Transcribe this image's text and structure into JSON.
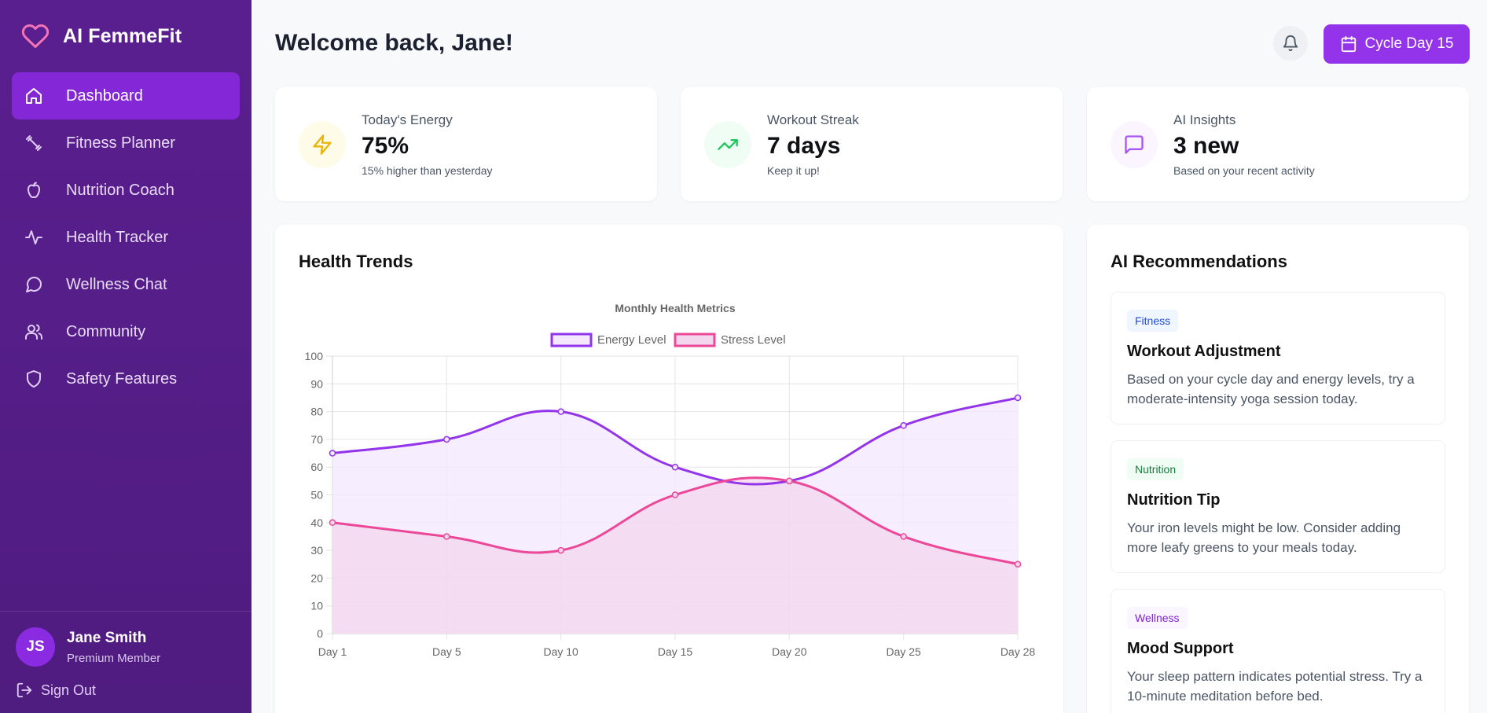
{
  "app": {
    "name": "AI FemmeFit",
    "logo_icon": "heart-icon",
    "brand_color": "#f472b6",
    "sidebar_color": "#5a1f8f",
    "accent_color": "#9333ea"
  },
  "sidebar": {
    "items": [
      {
        "label": "Dashboard",
        "icon": "home-icon",
        "active": true
      },
      {
        "label": "Fitness Planner",
        "icon": "dumbbell-icon",
        "active": false
      },
      {
        "label": "Nutrition Coach",
        "icon": "apple-icon",
        "active": false
      },
      {
        "label": "Health Tracker",
        "icon": "activity-icon",
        "active": false
      },
      {
        "label": "Wellness Chat",
        "icon": "chat-icon",
        "active": false
      },
      {
        "label": "Community",
        "icon": "users-icon",
        "active": false
      },
      {
        "label": "Safety Features",
        "icon": "shield-icon",
        "active": false
      }
    ],
    "user": {
      "initials": "JS",
      "name": "Jane Smith",
      "role": "Premium Member"
    },
    "signout_label": "Sign Out"
  },
  "header": {
    "title": "Welcome back, Jane!",
    "notification_icon": "bell-icon",
    "cycle_label": "Cycle Day 15",
    "cycle_icon": "calendar-icon"
  },
  "stats": [
    {
      "label": "Today's Energy",
      "value": "75%",
      "sub": "15% higher than yesterday",
      "icon": "lightning-icon",
      "icon_color": "#eab308",
      "icon_bg": "#fefce8"
    },
    {
      "label": "Workout Streak",
      "value": "7 days",
      "sub": "Keep it up!",
      "icon": "trending-up-icon",
      "icon_color": "#22c55e",
      "icon_bg": "#f0fdf4"
    },
    {
      "label": "AI Insights",
      "value": "3 new",
      "sub": "Based on your recent activity",
      "icon": "message-icon",
      "icon_color": "#a855f7",
      "icon_bg": "#faf5ff"
    }
  ],
  "health_trends": {
    "title": "Health Trends"
  },
  "chart_data": {
    "type": "line",
    "title": "Monthly Health Metrics",
    "categories": [
      "Day 1",
      "Day 5",
      "Day 10",
      "Day 15",
      "Day 20",
      "Day 25",
      "Day 28"
    ],
    "series": [
      {
        "name": "Energy Level",
        "values": [
          65,
          70,
          80,
          60,
          55,
          75,
          85
        ],
        "color": "#9333ea",
        "fill": "#f3e8fd"
      },
      {
        "name": "Stress Level",
        "values": [
          40,
          35,
          30,
          50,
          55,
          35,
          25
        ],
        "color": "#ec4899",
        "fill": "#f3d6ee"
      }
    ],
    "ylim": [
      0,
      100
    ],
    "yticks": [
      0,
      10,
      20,
      30,
      40,
      50,
      60,
      70,
      80,
      90,
      100
    ],
    "grid": true,
    "legend": "top-center",
    "filled": true,
    "smooth": true
  },
  "recommendations": {
    "title": "AI Recommendations",
    "items": [
      {
        "tag": "Fitness",
        "tag_color": "#1d4ed8",
        "tag_bg": "#eff6ff",
        "title": "Workout Adjustment",
        "text": "Based on your cycle day and energy levels, try a moderate-intensity yoga session today."
      },
      {
        "tag": "Nutrition",
        "tag_color": "#15803d",
        "tag_bg": "#f0fdf4",
        "title": "Nutrition Tip",
        "text": "Your iron levels might be low. Consider adding more leafy greens to your meals today."
      },
      {
        "tag": "Wellness",
        "tag_color": "#7e22ce",
        "tag_bg": "#faf5ff",
        "title": "Mood Support",
        "text": "Your sleep pattern indicates potential stress. Try a 10-minute meditation before bed."
      }
    ]
  }
}
